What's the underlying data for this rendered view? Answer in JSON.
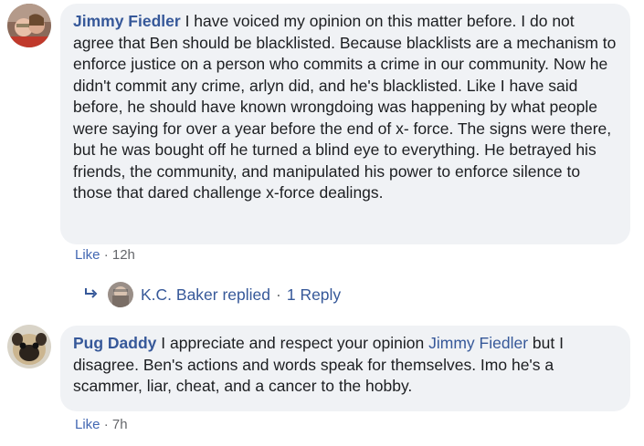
{
  "comments": [
    {
      "author": "Jimmy Fiedler",
      "text": "I have voiced my opinion on this matter before. I do not agree that Ben should be blacklisted. Because blacklists are a mechanism to enforce justice on a person who commits a crime in our community. Now he didn't commit any crime, arlyn did, and he's blacklisted. Like I have said before, he should have known wrongdoing was happening by what people were saying for over a year before the end of x- force. The signs were there, but he was bought off he turned a blind eye to everything. He betrayed his friends, the community, and manipulated his power to enforce silence to those that dared challenge x-force dealings.",
      "like_label": "Like",
      "separator": "·",
      "time": "12h",
      "replies": {
        "replier": "K.C. Baker replied",
        "separator": "·",
        "count_label": "1 Reply"
      }
    },
    {
      "author": "Pug Daddy",
      "text_before": "I appreciate and respect your opinion",
      "mention": "Jimmy Fiedler",
      "text_after": "but I disagree. Ben's actions and words speak for themselves. Imo he's a scammer, liar, cheat, and a cancer to the hobby.",
      "like_label": "Like",
      "separator": "·",
      "time": "7h"
    }
  ]
}
